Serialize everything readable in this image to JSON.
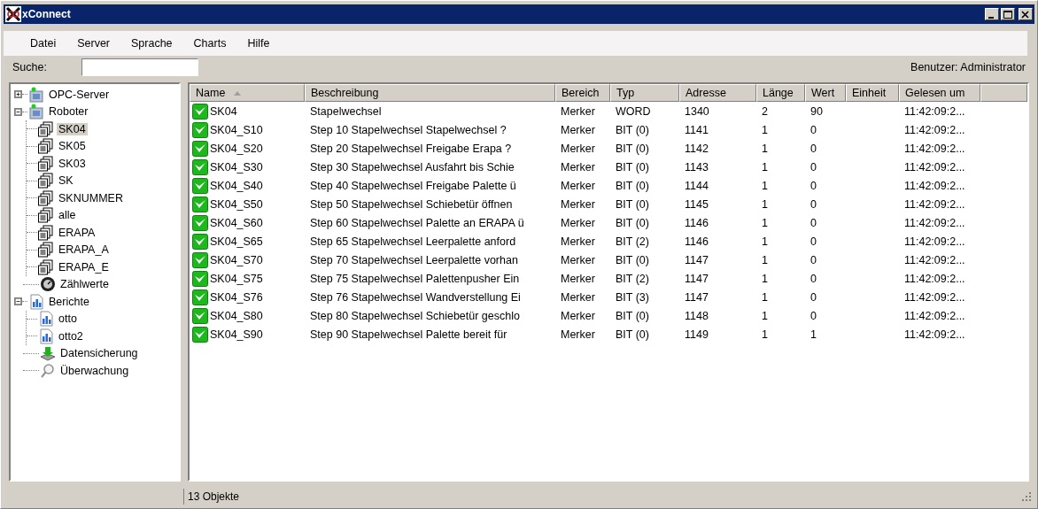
{
  "window": {
    "title": "xConnect"
  },
  "menu": [
    "Datei",
    "Server",
    "Sprache",
    "Charts",
    "Hilfe"
  ],
  "search": {
    "label": "Suche:"
  },
  "user": "Benutzer: Administrator",
  "tree": [
    {
      "label": "OPC-Server",
      "kind": "server",
      "expanded": false,
      "selected": false
    },
    {
      "label": "Roboter",
      "kind": "server",
      "expanded": true,
      "selected": false,
      "children": [
        {
          "label": "SK04",
          "kind": "document",
          "selected": true
        },
        {
          "label": "SK05",
          "kind": "document",
          "selected": false
        },
        {
          "label": "SK03",
          "kind": "document",
          "selected": false
        },
        {
          "label": "SK",
          "kind": "document",
          "selected": false
        },
        {
          "label": "SKNUMMER",
          "kind": "document",
          "selected": false
        },
        {
          "label": "alle",
          "kind": "document",
          "selected": false
        },
        {
          "label": "ERAPA",
          "kind": "document",
          "selected": false
        },
        {
          "label": "ERAPA_A",
          "kind": "document",
          "selected": false
        },
        {
          "label": "ERAPA_E",
          "kind": "document",
          "selected": false
        }
      ]
    },
    {
      "label": "Zählwerte",
      "kind": "gauge",
      "selected": false
    },
    {
      "label": "Berichte",
      "kind": "chart",
      "expanded": true,
      "selected": false,
      "children": [
        {
          "label": "otto",
          "kind": "chart",
          "selected": false
        },
        {
          "label": "otto2",
          "kind": "chart",
          "selected": false
        }
      ]
    },
    {
      "label": "Datensicherung",
      "kind": "backup",
      "selected": false
    },
    {
      "label": "Überwachung",
      "kind": "search",
      "selected": false
    }
  ],
  "table": {
    "columns": [
      {
        "label": "Name",
        "sorted": true
      },
      {
        "label": "Beschreibung"
      },
      {
        "label": "Bereich"
      },
      {
        "label": "Typ"
      },
      {
        "label": "Adresse"
      },
      {
        "label": "Länge"
      },
      {
        "label": "Wert"
      },
      {
        "label": "Einheit"
      },
      {
        "label": "Gelesen um"
      }
    ],
    "rows": [
      {
        "ok": true,
        "cells": [
          "SK04",
          "Stapelwechsel",
          "Merker",
          "WORD",
          "1340",
          "2",
          "90",
          "",
          "11:42:09:2..."
        ]
      },
      {
        "ok": true,
        "cells": [
          "SK04_S10",
          "Step 10 Stapelwechsel Stapelwechsel ?",
          "Merker",
          "BIT (0)",
          "1141",
          "1",
          "0",
          "",
          "11:42:09:2..."
        ]
      },
      {
        "ok": true,
        "cells": [
          "SK04_S20",
          "Step 20 Stapelwechsel Freigabe Erapa ?",
          "Merker",
          "BIT (0)",
          "1142",
          "1",
          "0",
          "",
          "11:42:09:2..."
        ]
      },
      {
        "ok": true,
        "cells": [
          "SK04_S30",
          "Step 30 Stapelwechsel Ausfahrt bis Schie",
          "Merker",
          "BIT (0)",
          "1143",
          "1",
          "0",
          "",
          "11:42:09:2..."
        ]
      },
      {
        "ok": true,
        "cells": [
          "SK04_S40",
          "Step 40 Stapelwechsel Freigabe Palette ü",
          "Merker",
          "BIT (0)",
          "1144",
          "1",
          "0",
          "",
          "11:42:09:2..."
        ]
      },
      {
        "ok": true,
        "cells": [
          "SK04_S50",
          "Step 50 Stapelwechsel Schiebetür öffnen",
          "Merker",
          "BIT (0)",
          "1145",
          "1",
          "0",
          "",
          "11:42:09:2..."
        ]
      },
      {
        "ok": true,
        "cells": [
          "SK04_S60",
          "Step 60 Stapelwechsel Palette an ERAPA ü",
          "Merker",
          "BIT (0)",
          "1146",
          "1",
          "0",
          "",
          "11:42:09:2..."
        ]
      },
      {
        "ok": true,
        "cells": [
          "SK04_S65",
          "Step 65 Stapelwechsel Leerpalette anford",
          "Merker",
          "BIT (2)",
          "1146",
          "1",
          "0",
          "",
          "11:42:09:2..."
        ]
      },
      {
        "ok": true,
        "cells": [
          "SK04_S70",
          "Step 70 Stapelwechsel Leerpalette vorhan",
          "Merker",
          "BIT (0)",
          "1147",
          "1",
          "0",
          "",
          "11:42:09:2..."
        ]
      },
      {
        "ok": true,
        "cells": [
          "SK04_S75",
          "Step 75 Stapelwechsel Palettenpusher Ein",
          "Merker",
          "BIT (2)",
          "1147",
          "1",
          "0",
          "",
          "11:42:09:2..."
        ]
      },
      {
        "ok": true,
        "cells": [
          "SK04_S76",
          "Step 76 Stapelwechsel Wandverstellung Ei",
          "Merker",
          "BIT (3)",
          "1147",
          "1",
          "0",
          "",
          "11:42:09:2..."
        ]
      },
      {
        "ok": true,
        "cells": [
          "SK04_S80",
          "Step 80 Stapelwechsel Schiebetür geschlo",
          "Merker",
          "BIT (0)",
          "1148",
          "1",
          "0",
          "",
          "11:42:09:2..."
        ]
      },
      {
        "ok": true,
        "cells": [
          "SK04_S90",
          "Step 90 Stapelwechsel Palette bereit für",
          "Merker",
          "BIT (0)",
          "1149",
          "1",
          "1",
          "",
          "11:42:09:2..."
        ]
      }
    ]
  },
  "status_bar": {
    "count": "13 Objekte"
  }
}
